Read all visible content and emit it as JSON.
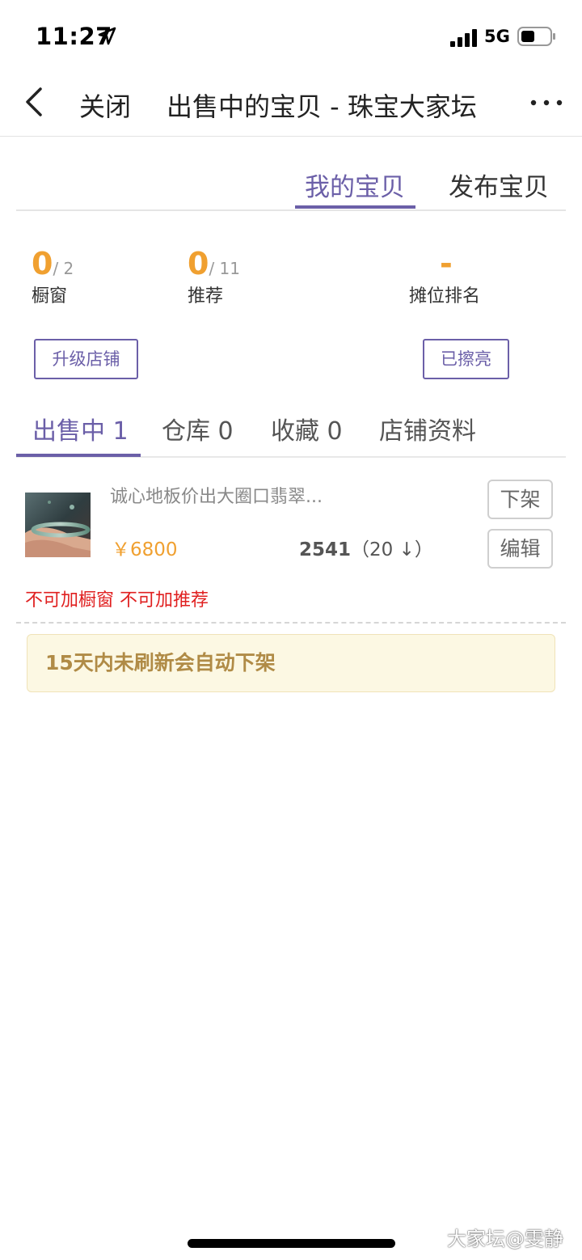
{
  "status_bar": {
    "time": "11:27",
    "network": "5G",
    "icons": [
      "location-arrow-icon",
      "signal-bars-icon",
      "battery-icon"
    ]
  },
  "nav": {
    "close_label": "关闭",
    "title": "出售中的宝贝 - 珠宝大家坛",
    "icons": [
      "back-chevron-icon",
      "more-dots-icon"
    ]
  },
  "top_tabs": [
    {
      "label": "我的宝贝",
      "active": true
    },
    {
      "label": "发布宝贝",
      "active": false
    }
  ],
  "stats": {
    "window": {
      "value": "0",
      "total": "/ 2",
      "label": "橱窗"
    },
    "recommend": {
      "value": "0",
      "total": "/ 11",
      "label": "推荐"
    },
    "rank": {
      "value": "-",
      "label": "摊位排名"
    }
  },
  "buttons": {
    "upgrade": "升级店铺",
    "polished": "已擦亮"
  },
  "sub_tabs": [
    {
      "label": "出售中 1",
      "active": true
    },
    {
      "label": "仓库 0",
      "active": false
    },
    {
      "label": "收藏 0",
      "active": false
    },
    {
      "label": "店铺资料",
      "active": false
    }
  ],
  "product": {
    "title": "诚心地板价出大圈口翡翠...",
    "price": "￥6800",
    "views": "2541",
    "views_delta": "（20 ↓）",
    "off_shelf_label": "下架",
    "edit_label": "编辑",
    "warning": "不可加橱窗 不可加推荐"
  },
  "notice": "15天内未刷新会自动下架",
  "watermark": "大家坛@雯静",
  "colors": {
    "accent": "#6b5fa8",
    "orange": "#f0a030",
    "warning_red": "#e02020",
    "notice_bg": "#fcf8e3",
    "notice_text": "#b08b46"
  }
}
